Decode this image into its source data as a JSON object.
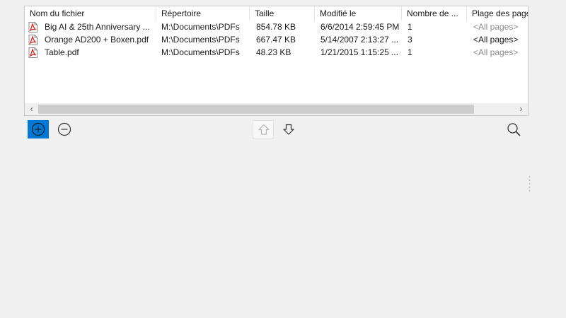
{
  "columns": [
    {
      "key": "name",
      "label": "Nom du fichier"
    },
    {
      "key": "dir",
      "label": "Répertoire"
    },
    {
      "key": "size",
      "label": "Taille"
    },
    {
      "key": "modified",
      "label": "Modifié le"
    },
    {
      "key": "pages",
      "label": "Nombre de ..."
    },
    {
      "key": "range",
      "label": "Plage des pages"
    }
  ],
  "files": [
    {
      "name": "Big AI & 25th Anniversary ...",
      "dir": "M:\\Documents\\PDFs",
      "size": "854.78 KB",
      "modified": "6/6/2014 2:59:45 PM",
      "pages": "1",
      "range": "<All pages>",
      "range_dim": true
    },
    {
      "name": "Orange AD200 + Boxen.pdf",
      "dir": "M:\\Documents\\PDFs",
      "size": "667.47 KB",
      "modified": "5/14/2007 2:13:27 ...",
      "pages": "3",
      "range": "<All pages>",
      "range_dim": false
    },
    {
      "name": "Table.pdf",
      "dir": "M:\\Documents\\PDFs",
      "size": "48.23 KB",
      "modified": "1/21/2015 1:15:25 ...",
      "pages": "1",
      "range": "<All pages>",
      "range_dim": true
    }
  ],
  "scrollbar": {
    "left_glyph": "‹",
    "right_glyph": "›"
  },
  "icons": {
    "file": "pdf-file-icon",
    "add": "add-circle-icon",
    "remove": "remove-circle-icon",
    "up": "arrow-up-icon",
    "down": "arrow-down-icon",
    "search": "magnifier-icon"
  },
  "colors": {
    "accent": "#0078d7",
    "pdf_red": "#d9251c",
    "panel_bg": "#ffffff",
    "window_bg": "#f0f0f0"
  }
}
